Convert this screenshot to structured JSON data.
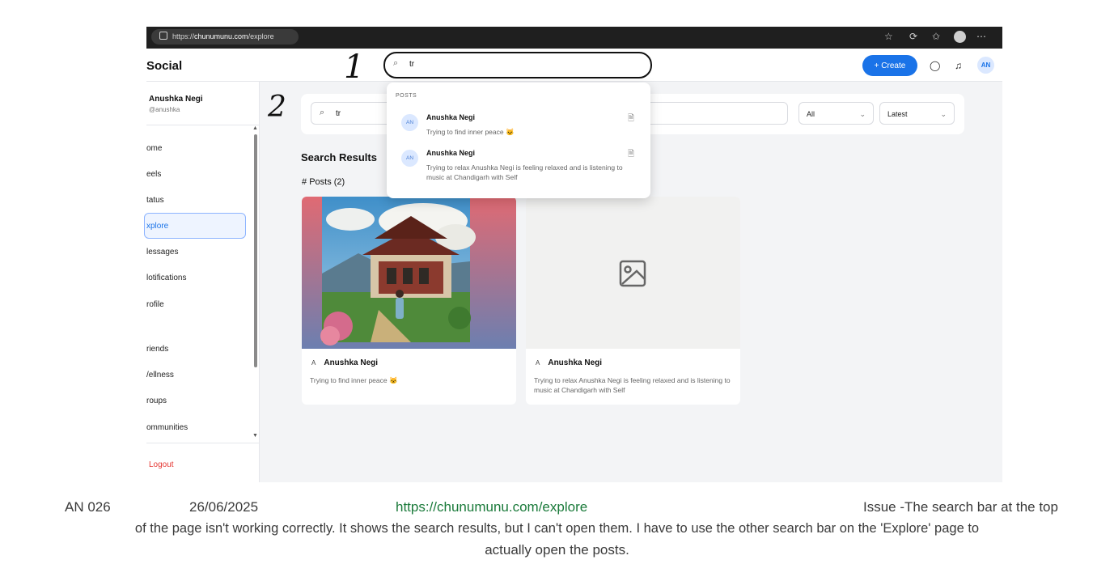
{
  "browser": {
    "url_scheme": "https://",
    "url_host": "chunumunu.com",
    "url_path": "/explore"
  },
  "app": {
    "logo": "Social",
    "top_search": {
      "value": "tr"
    },
    "create_label": "Create",
    "avatar_initials": "AN"
  },
  "sidebar": {
    "profile_name": "Anushka Negi",
    "profile_handle": "@anushka",
    "items": [
      {
        "label": "ome"
      },
      {
        "label": "eels"
      },
      {
        "label": "tatus"
      },
      {
        "label": "xplore"
      },
      {
        "label": "lessages"
      },
      {
        "label": "lotifications"
      },
      {
        "label": "rofile"
      },
      {
        "label": "riends"
      },
      {
        "label": "/ellness"
      },
      {
        "label": "roups"
      },
      {
        "label": "ommunities"
      }
    ],
    "logout": "Logout"
  },
  "explore": {
    "search_value": "tr",
    "type_filter": "All",
    "sort_filter": "Latest",
    "results_title": "Search Results",
    "posts_label": "Posts (2)",
    "cards": [
      {
        "avatar": "A",
        "author": "Anushka Negi",
        "text": "Trying to find inner peace 🐱"
      },
      {
        "avatar": "A",
        "author": "Anushka Negi",
        "text": "Trying to relax Anushka Negi is feeling relaxed and is listening to music at Chandigarh with Self"
      }
    ]
  },
  "dropdown": {
    "section_label": "POSTS",
    "results": [
      {
        "avatar": "AN",
        "author": "Anushka Negi",
        "text": "Trying to find inner peace 🐱"
      },
      {
        "avatar": "AN",
        "author": "Anushka Negi",
        "text": "Trying to relax Anushka Negi is feeling relaxed and is listening to music at Chandigarh with Self"
      }
    ]
  },
  "annotations": {
    "one": "1",
    "two": "2"
  },
  "caption": {
    "id": "AN 026",
    "date": "26/06/2025",
    "url": "https://chunumunu.com/explore",
    "issue_line1": "Issue -The search bar at the top",
    "issue_line2": "of the page isn't working correctly. It shows the search results, but I can't open them. I have to use the other search bar on the 'Explore' page to",
    "issue_line3": "actually open the posts."
  },
  "colors": {
    "accent": "#1a73e8",
    "logout": "#e53935",
    "caption_link": "#1a7a3a",
    "browser_chrome": "#1f1f1f"
  }
}
